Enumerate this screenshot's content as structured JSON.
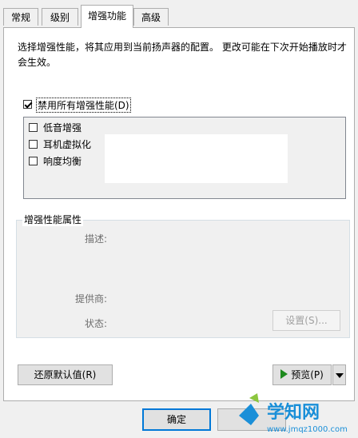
{
  "tabs": [
    "常规",
    "级别",
    "增强功能",
    "高级"
  ],
  "description": "选择增强性能，将其应用到当前扬声器的配置。 更改可能在下次开始播放时才会生效。",
  "disable_all": {
    "label": "禁用所有增强性能(D)",
    "checked": true
  },
  "enhancements": [
    {
      "label": "低音增强",
      "checked": false
    },
    {
      "label": "耳机虚拟化",
      "checked": false
    },
    {
      "label": "响度均衡",
      "checked": false
    }
  ],
  "properties": {
    "title": "增强性能属性",
    "description_label": "描述:",
    "provider_label": "提供商:",
    "status_label": "状态:",
    "settings_button": "设置(S)..."
  },
  "restore_defaults_button": "还原默认值(R)",
  "preview_button": "预览(P)",
  "ok_button": "确定",
  "watermark": {
    "brand": "学知网",
    "url": "www.jmqz1000.com"
  },
  "colors": {
    "accent": "#0078d7",
    "play": "#1e8a1e",
    "watermark": "#1a8fd8"
  }
}
